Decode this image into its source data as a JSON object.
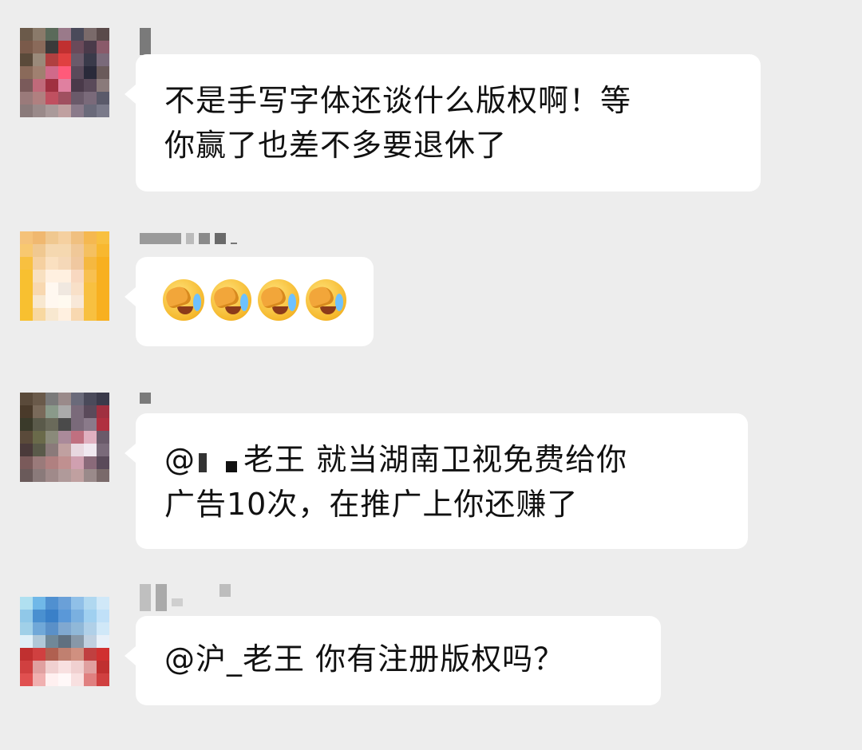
{
  "chat": {
    "messages": [
      {
        "sender_name": "",
        "text": "不是手写字体还谈什么版权啊！等\n你赢了也差不多要退休了"
      },
      {
        "sender_name": "",
        "emoji": [
          "facepalm-crying",
          "facepalm-crying",
          "facepalm-crying",
          "facepalm-crying"
        ]
      },
      {
        "sender_name": "",
        "mention_prefix": "@",
        "text": "老王 就当湖南卫视免费给你\n广告10次，在推广上你还赚了"
      },
      {
        "sender_name": "",
        "text": "@沪_老王 你有注册版权吗？"
      }
    ]
  },
  "avatar_colors": {
    "a1": [
      "#6b5a4a",
      "#8a7a6a",
      "#5a6a5a",
      "#9a7a8a",
      "#4a4a5a",
      "#7a6a6a",
      "#5a4a4a",
      "#7a5a4a",
      "#8a6a5a",
      "#3a3a3a",
      "#c03030",
      "#6a4a5a",
      "#4a3a4a",
      "#8a5a6a",
      "#5a4a3a",
      "#9a8a7a",
      "#b04040",
      "#e04040",
      "#6a5a6a",
      "#3a3a4a",
      "#7a6a7a",
      "#8a6a5a",
      "#a08070",
      "#d06a8a",
      "#ff5a7a",
      "#5a4a5a",
      "#2a2a3a",
      "#6a5a5a",
      "#7a5a5a",
      "#c06a7a",
      "#a03040",
      "#e080a0",
      "#4a3a4a",
      "#5a4a5a",
      "#8a7a7a",
      "#9a7a7a",
      "#b08080",
      "#c05060",
      "#a05060",
      "#6a5a6a",
      "#7a6a7a",
      "#5a5a6a",
      "#8a7a7a",
      "#9a8a8a",
      "#aa9a9a",
      "#c0a0a0",
      "#8a7a8a",
      "#6a6a7a",
      "#7a7a8a"
    ],
    "a2": [
      "#f5c27a",
      "#f0b870",
      "#f0c890",
      "#f5d0a0",
      "#f0c080",
      "#f5b850",
      "#f8c040",
      "#f8c870",
      "#f0c890",
      "#f5d8b0",
      "#f5d8b0",
      "#f0c898",
      "#f5c060",
      "#f8b830",
      "#f8c040",
      "#f5d0a0",
      "#fae0c0",
      "#f5d8b8",
      "#f0c8a0",
      "#f5b840",
      "#f8b020",
      "#f8c030",
      "#f8e0c0",
      "#fff0e0",
      "#fff0e0",
      "#f8d8c0",
      "#f8c050",
      "#f8b020",
      "#f8c030",
      "#f8d8b0",
      "#fff8f0",
      "#f0e8e0",
      "#f8e0c8",
      "#f8c040",
      "#f8b020",
      "#f8c030",
      "#f8e8d0",
      "#fff8f0",
      "#fffaf0",
      "#f8e8d8",
      "#f8c040",
      "#f8b020",
      "#f8c030",
      "#f8d8a0",
      "#f8e8d0",
      "#fff0e0",
      "#f8d8b0",
      "#f8c040",
      "#f8b020"
    ],
    "a3": [
      "#5a4a3a",
      "#6a5a4a",
      "#7a7a7a",
      "#9a8a8a",
      "#6a6a7a",
      "#4a4a5a",
      "#3a3a4a",
      "#4a3a2a",
      "#7a6a5a",
      "#8a9a8a",
      "#aaaaaa",
      "#7a6a7a",
      "#5a4a5a",
      "#a03040",
      "#3a3a2a",
      "#5a5a4a",
      "#6a6a5a",
      "#4a4a4a",
      "#7a6a7a",
      "#8a7a8a",
      "#b03040",
      "#5a4a3a",
      "#6a6a4a",
      "#8a8a7a",
      "#aa8a9a",
      "#c07080",
      "#e0b0c0",
      "#6a5a6a",
      "#4a3a3a",
      "#5a5a4a",
      "#8a7a7a",
      "#c0a0a0",
      "#e8d8e0",
      "#f0e8f0",
      "#7a6a7a",
      "#7a5a5a",
      "#9a7a7a",
      "#b08080",
      "#c09090",
      "#d0a0b0",
      "#8a6a7a",
      "#5a4a5a",
      "#6a5a5a",
      "#8a7a7a",
      "#a08a8a",
      "#b09a9a",
      "#c0a0a0",
      "#9a8a8a",
      "#7a6a6a"
    ],
    "a4": [
      "#b0e0f0",
      "#70b8e8",
      "#5090d0",
      "#6aa0d8",
      "#90c0e8",
      "#b0d8f0",
      "#d0e8f8",
      "#90c8e8",
      "#4a90d0",
      "#3a80c8",
      "#5a98d8",
      "#7ab0e0",
      "#a0d0f0",
      "#c0e0f8",
      "#a0d0e8",
      "#70a8d8",
      "#5a90c8",
      "#80a8d0",
      "#90b8d8",
      "#b0d0e8",
      "#d0e8f8",
      "#e0f0f8",
      "#b0c8d8",
      "#708898",
      "#607080",
      "#8898a8",
      "#c0d0e0",
      "#e8f0f8",
      "#c03030",
      "#d04040",
      "#b06050",
      "#c08070",
      "#d09080",
      "#c04040",
      "#d03030",
      "#d04040",
      "#e0a0a0",
      "#f0d0d0",
      "#f8e0e0",
      "#f0d0d0",
      "#e0a0a0",
      "#c03030",
      "#e05050",
      "#f0b0b0",
      "#fff0f0",
      "#fff8f8",
      "#f8e0e0",
      "#e08080",
      "#d04040"
    ]
  }
}
